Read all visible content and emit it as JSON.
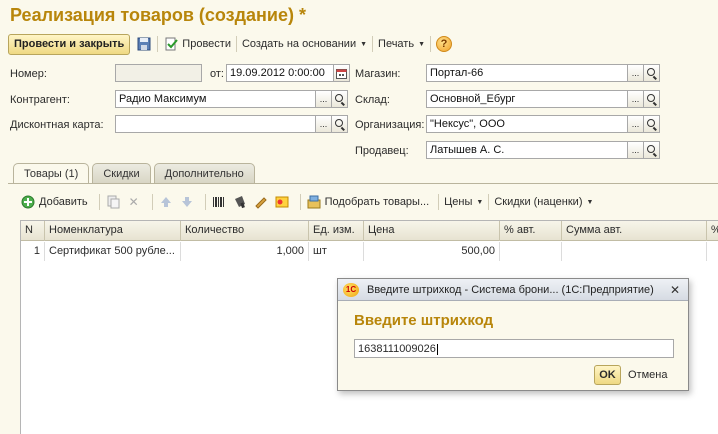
{
  "window": {
    "title": "Реализация товаров (создание) *"
  },
  "toolbar": {
    "post_close_label": "Провести и закрыть",
    "post_label": "Провести",
    "create_based_label": "Создать на основании",
    "print_label": "Печать",
    "help_label": "?"
  },
  "form": {
    "number_label": "Номер:",
    "number_value": "",
    "date_label": "от:",
    "date_value": "19.09.2012  0:00:00",
    "counterparty_label": "Контрагент:",
    "counterparty_value": "Радио Максимум",
    "discount_card_label": "Дисконтная карта:",
    "discount_card_value": "",
    "store_label": "Магазин:",
    "store_value": "Портал-66",
    "warehouse_label": "Склад:",
    "warehouse_value": "Основной_Ебург",
    "organization_label": "Организация:",
    "organization_value": "\"Нексус\", ООО",
    "seller_label": "Продавец:",
    "seller_value": "Латышев А. С.",
    "ellipsis": "..."
  },
  "tabs": [
    {
      "label": "Товары (1)",
      "active": true
    },
    {
      "label": "Скидки",
      "active": false
    },
    {
      "label": "Дополнительно",
      "active": false
    }
  ],
  "grid_toolbar": {
    "add_label": "Добавить",
    "pick_goods_label": "Подобрать товары...",
    "prices_label": "Цены",
    "discounts_label": "Скидки (наценки)"
  },
  "table": {
    "headers": [
      "N",
      "Номенклатура",
      "Количество",
      "Ед. изм.",
      "Цена",
      "% авт.",
      "Сумма авт.",
      "%"
    ],
    "rows": [
      [
        "1",
        "Сертификат 500 рубле...",
        "1,000",
        "шт",
        "500,00",
        "",
        "",
        ""
      ]
    ]
  },
  "dialog": {
    "title": "Введите штрихкод - Система брони...   (1С:Предприятие)",
    "heading": "Введите штрихкод",
    "input_value": "1638111009026",
    "ok_label": "OK",
    "cancel_label": "Отмена",
    "close_label": "✕",
    "logo_label": "1С"
  },
  "colors": {
    "title": "#b8860b",
    "background": "#fbf9ec",
    "button_gradient_top": "#fff5c6",
    "button_gradient_bottom": "#efd983"
  }
}
